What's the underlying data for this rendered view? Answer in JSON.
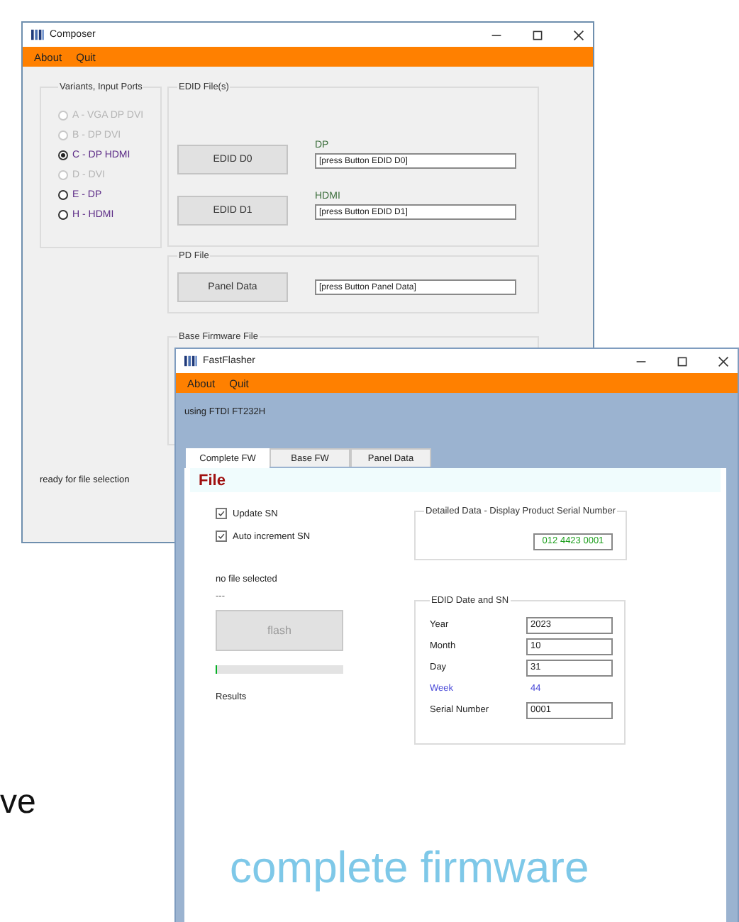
{
  "background_text": "ve",
  "composer": {
    "title": "Composer",
    "menu": [
      "About",
      "Quit"
    ],
    "variants": {
      "title": "Variants, Input Ports",
      "options": [
        {
          "label": "A - VGA DP DVI",
          "selected": false,
          "disabled": true
        },
        {
          "label": "B - DP DVI",
          "selected": false,
          "disabled": true
        },
        {
          "label": "C - DP HDMI",
          "selected": true,
          "disabled": false
        },
        {
          "label": "D - DVI",
          "selected": false,
          "disabled": true
        },
        {
          "label": "E - DP",
          "selected": false,
          "disabled": false
        },
        {
          "label": "H - HDMI",
          "selected": false,
          "disabled": false
        }
      ]
    },
    "edid": {
      "title": "EDID File(s)",
      "rows": [
        {
          "button": "EDID D0",
          "label": "DP",
          "value": "[press Button EDID D0]"
        },
        {
          "button": "EDID D1",
          "label": "HDMI",
          "value": "[press Button EDID D1]"
        }
      ]
    },
    "pd_file": {
      "title": "PD File",
      "button": "Panel Data",
      "value": "[press Button Panel Data]"
    },
    "base_firmware": {
      "title": "Base Firmware File"
    },
    "status": "ready for file selection"
  },
  "flasher": {
    "title": "FastFlasher",
    "menu": [
      "About",
      "Quit"
    ],
    "device": "using FTDI FT232H",
    "tabs": [
      {
        "label": "Complete FW",
        "selected": true
      },
      {
        "label": "Base FW",
        "selected": false
      },
      {
        "label": "Panel Data",
        "selected": false
      }
    ],
    "section_title": "File",
    "checkboxes": [
      {
        "label": "Update SN",
        "checked": true
      },
      {
        "label": "Auto increment SN",
        "checked": true
      }
    ],
    "file_status": "no file selected",
    "file_detail": "---",
    "flash_button": {
      "label": "flash",
      "disabled": true
    },
    "progress": {
      "level": 0
    },
    "results_label": "Results",
    "detailed": {
      "title": "Detailed Data - Display Product Serial Number",
      "value": "012 4423 0001"
    },
    "edid_date": {
      "title": "EDID Date and SN",
      "rows": [
        {
          "kind": "field",
          "label": "Year",
          "value": "2023"
        },
        {
          "kind": "field",
          "label": "Month",
          "value": "10"
        },
        {
          "kind": "field",
          "label": "Day",
          "value": "31"
        },
        {
          "kind": "readout",
          "label": "Week",
          "value": "44"
        },
        {
          "kind": "field",
          "label": "Serial Number",
          "value": "0001"
        }
      ]
    },
    "banner": "complete firmware"
  }
}
